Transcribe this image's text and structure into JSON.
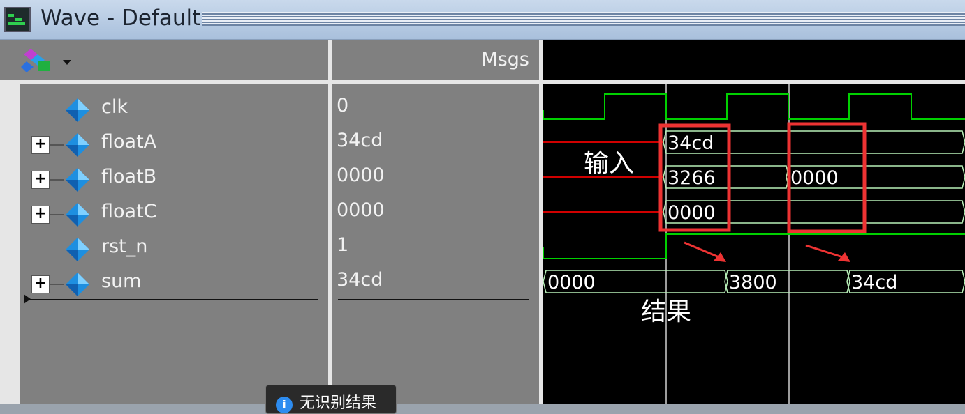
{
  "window": {
    "title": "Wave - Default"
  },
  "toolbar": {
    "icon": "wave-objects-icon"
  },
  "columns": {
    "msgs_header": "Msgs"
  },
  "signals": [
    {
      "name": "clk",
      "value": "0",
      "expandable": false
    },
    {
      "name": "floatA",
      "value": "34cd",
      "expandable": true
    },
    {
      "name": "floatB",
      "value": "0000",
      "expandable": true
    },
    {
      "name": "floatC",
      "value": "0000",
      "expandable": true
    },
    {
      "name": "rst_n",
      "value": "1",
      "expandable": false
    },
    {
      "name": "sum",
      "value": "34cd",
      "expandable": true
    }
  ],
  "waveform": {
    "bus_values": {
      "floatA": [
        "34cd"
      ],
      "floatB": [
        "3266",
        "0000"
      ],
      "floatC": [
        "0000"
      ],
      "sum": [
        "0000",
        "3800",
        "34cd"
      ]
    },
    "colors": {
      "signal": "#00d000",
      "bus": "#b8f0b8",
      "unknown": "#d00000",
      "grid": "#d0d0d0",
      "highlight": "#ee3333"
    }
  },
  "annotations": {
    "input_label": "输入",
    "result_label": "结果"
  },
  "tooltip": {
    "text": "无识别结果"
  }
}
